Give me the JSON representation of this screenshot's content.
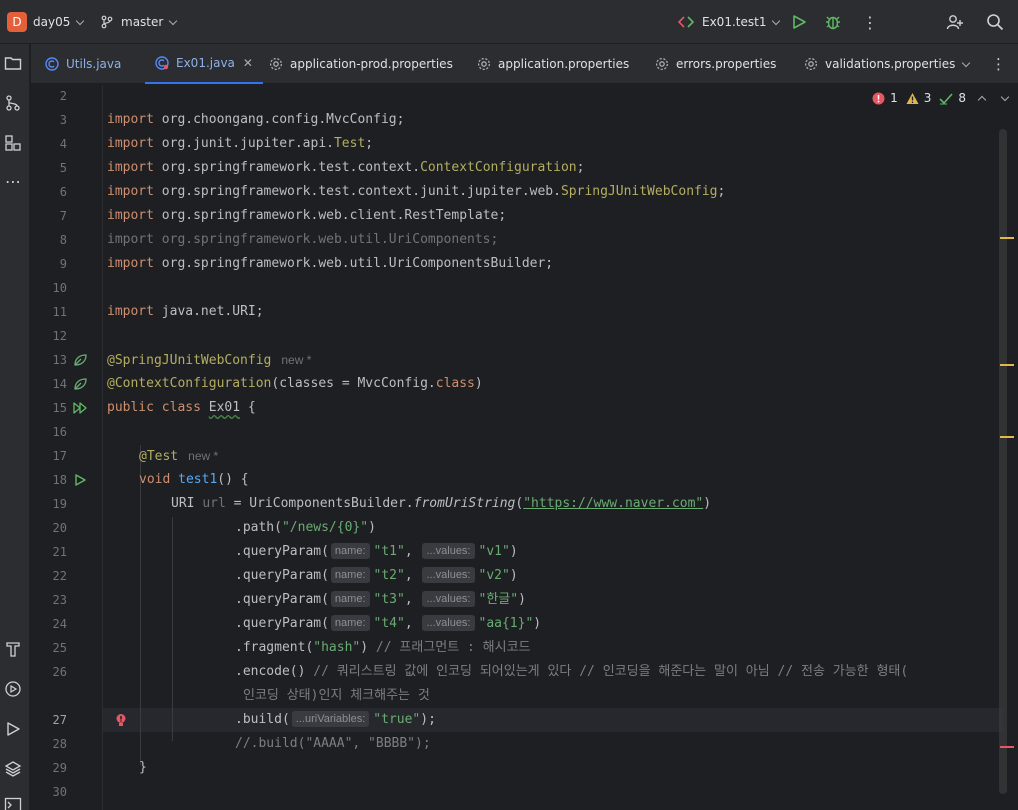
{
  "titlebar": {
    "project_badge": "D",
    "project_name": "day05",
    "branch": "master",
    "run_config": "Ex01.test1"
  },
  "tabs": [
    {
      "label": "Utils.java",
      "icon": "java-class-icon",
      "active": false
    },
    {
      "label": "Ex01.java",
      "icon": "java-class-icon",
      "active": true,
      "close": "✕"
    },
    {
      "label": "application-prod.properties",
      "icon": "gear-icon",
      "active": false
    },
    {
      "label": "application.properties",
      "icon": "gear-icon",
      "active": false
    },
    {
      "label": "errors.properties",
      "icon": "gear-icon",
      "active": false
    },
    {
      "label": "validations.properties",
      "icon": "gear-icon",
      "active": false
    }
  ],
  "inspections": {
    "errors": "1",
    "warnings": "3",
    "ok": "8"
  },
  "line_numbers": [
    "2",
    "3",
    "4",
    "5",
    "6",
    "7",
    "8",
    "9",
    "10",
    "11",
    "12",
    "13",
    "14",
    "15",
    "16",
    "17",
    "18",
    "19",
    "20",
    "21",
    "22",
    "23",
    "24",
    "25",
    "26",
    "",
    "27",
    "28",
    "29",
    "30"
  ],
  "current_line": "27",
  "code": {
    "import_kw": "import",
    "l3": "org.choongang.config.MvcConfig;",
    "l4a": "org.junit.jupiter.api.",
    "l4b": "Test",
    "l5a": "org.springframework.test.context.",
    "l5b": "ContextConfiguration",
    "l6a": "org.springframework.test.context.junit.jupiter.web.",
    "l6b": "SpringJUnitWebConfig",
    "l7": "org.springframework.web.client.RestTemplate;",
    "l8": "import org.springframework.web.util.UriComponents;",
    "l9": "org.springframework.web.util.UriComponentsBuilder;",
    "l11": "java.net.URI;",
    "l13": "@SpringJUnitWebConfig",
    "new_hint": "new *",
    "l14a": "@ContextConfiguration",
    "l14b": "(classes = MvcConfig.",
    "l14c": "class",
    "l14d": ")",
    "l15a": "public class ",
    "l15b": "Ex01",
    "l15c": " {",
    "l17": "@Test",
    "l18a": "void ",
    "l18b": "test1",
    "l18c": "() {",
    "l19a": "URI ",
    "l19b": "url",
    "l19c": " = UriComponentsBuilder.",
    "l19d": "fromUriString",
    "l19e": "(",
    "l19f": "\"https://www.naver.com\"",
    "l19g": ")",
    "l20a": ".path(",
    "l20b": "\"/news/{0}\"",
    "l20c": ")",
    "qp": ".queryParam(",
    "hint_name": "name:",
    "hint_values": "...values:",
    "l21a": "\"t1\"",
    "l21b": "\"v1\"",
    "l22a": "\"t2\"",
    "l22b": "\"v2\"",
    "l23a": "\"t3\"",
    "l23b": "\"한글\"",
    "l24a": "\"t4\"",
    "l24b": "\"aa{1}\"",
    "close_paren": ")",
    "comma": ", ",
    "l25a": ".fragment(",
    "l25b": "\"hash\"",
    "l25c": ") ",
    "l25d": "// 프래그먼트 : 해시코드",
    "l26a": ".encode() ",
    "l26b": "// 쿼리스트링 값에 인코딩 되어있는게 있다 // 인코딩을 해준다는 말이 아님 // 전송 가능한 형태(",
    "l26c": "인코딩 상태)인지 체크해주는 것",
    "l27a": ".build(",
    "hint_urivars": "...uriVariables:",
    "l27b": "\"true\"",
    "l27c": ");",
    "l28": "//.build(\"AAAA\", \"BBBB\");",
    "l29": "}"
  },
  "colors": {
    "accent": "#3574f0",
    "error": "#e55765",
    "warning": "#e0b94a",
    "ok": "#5fb865",
    "run_green": "#5fb865"
  }
}
